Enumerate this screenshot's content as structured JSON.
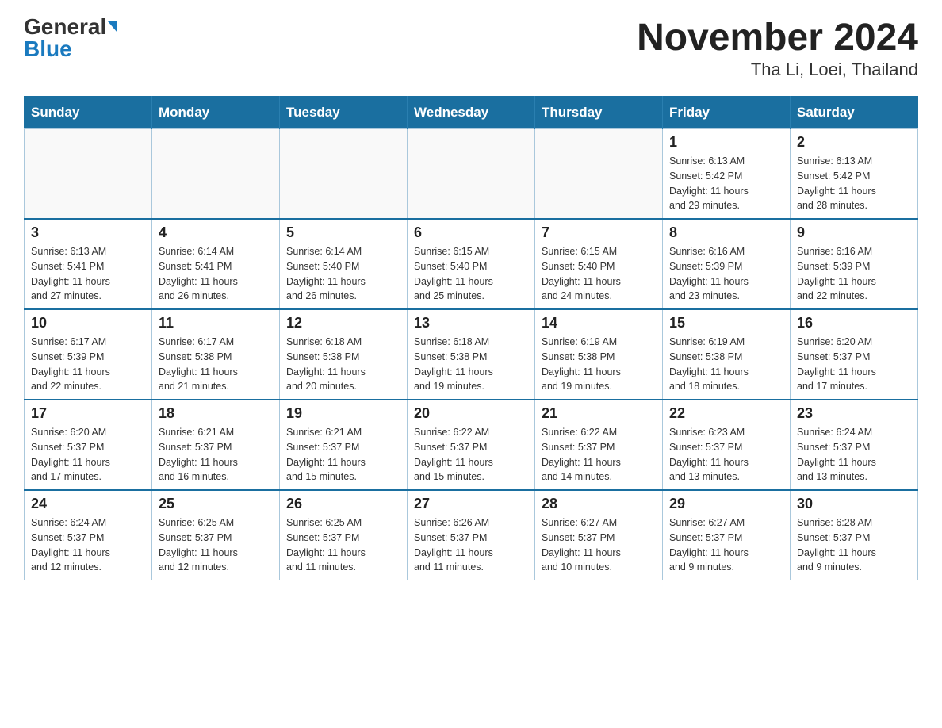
{
  "header": {
    "logo_general": "General",
    "logo_blue": "Blue",
    "title": "November 2024",
    "subtitle": "Tha Li, Loei, Thailand"
  },
  "days_of_week": [
    "Sunday",
    "Monday",
    "Tuesday",
    "Wednesday",
    "Thursday",
    "Friday",
    "Saturday"
  ],
  "weeks": [
    {
      "days": [
        {
          "num": "",
          "info": ""
        },
        {
          "num": "",
          "info": ""
        },
        {
          "num": "",
          "info": ""
        },
        {
          "num": "",
          "info": ""
        },
        {
          "num": "",
          "info": ""
        },
        {
          "num": "1",
          "info": "Sunrise: 6:13 AM\nSunset: 5:42 PM\nDaylight: 11 hours\nand 29 minutes."
        },
        {
          "num": "2",
          "info": "Sunrise: 6:13 AM\nSunset: 5:42 PM\nDaylight: 11 hours\nand 28 minutes."
        }
      ]
    },
    {
      "days": [
        {
          "num": "3",
          "info": "Sunrise: 6:13 AM\nSunset: 5:41 PM\nDaylight: 11 hours\nand 27 minutes."
        },
        {
          "num": "4",
          "info": "Sunrise: 6:14 AM\nSunset: 5:41 PM\nDaylight: 11 hours\nand 26 minutes."
        },
        {
          "num": "5",
          "info": "Sunrise: 6:14 AM\nSunset: 5:40 PM\nDaylight: 11 hours\nand 26 minutes."
        },
        {
          "num": "6",
          "info": "Sunrise: 6:15 AM\nSunset: 5:40 PM\nDaylight: 11 hours\nand 25 minutes."
        },
        {
          "num": "7",
          "info": "Sunrise: 6:15 AM\nSunset: 5:40 PM\nDaylight: 11 hours\nand 24 minutes."
        },
        {
          "num": "8",
          "info": "Sunrise: 6:16 AM\nSunset: 5:39 PM\nDaylight: 11 hours\nand 23 minutes."
        },
        {
          "num": "9",
          "info": "Sunrise: 6:16 AM\nSunset: 5:39 PM\nDaylight: 11 hours\nand 22 minutes."
        }
      ]
    },
    {
      "days": [
        {
          "num": "10",
          "info": "Sunrise: 6:17 AM\nSunset: 5:39 PM\nDaylight: 11 hours\nand 22 minutes."
        },
        {
          "num": "11",
          "info": "Sunrise: 6:17 AM\nSunset: 5:38 PM\nDaylight: 11 hours\nand 21 minutes."
        },
        {
          "num": "12",
          "info": "Sunrise: 6:18 AM\nSunset: 5:38 PM\nDaylight: 11 hours\nand 20 minutes."
        },
        {
          "num": "13",
          "info": "Sunrise: 6:18 AM\nSunset: 5:38 PM\nDaylight: 11 hours\nand 19 minutes."
        },
        {
          "num": "14",
          "info": "Sunrise: 6:19 AM\nSunset: 5:38 PM\nDaylight: 11 hours\nand 19 minutes."
        },
        {
          "num": "15",
          "info": "Sunrise: 6:19 AM\nSunset: 5:38 PM\nDaylight: 11 hours\nand 18 minutes."
        },
        {
          "num": "16",
          "info": "Sunrise: 6:20 AM\nSunset: 5:37 PM\nDaylight: 11 hours\nand 17 minutes."
        }
      ]
    },
    {
      "days": [
        {
          "num": "17",
          "info": "Sunrise: 6:20 AM\nSunset: 5:37 PM\nDaylight: 11 hours\nand 17 minutes."
        },
        {
          "num": "18",
          "info": "Sunrise: 6:21 AM\nSunset: 5:37 PM\nDaylight: 11 hours\nand 16 minutes."
        },
        {
          "num": "19",
          "info": "Sunrise: 6:21 AM\nSunset: 5:37 PM\nDaylight: 11 hours\nand 15 minutes."
        },
        {
          "num": "20",
          "info": "Sunrise: 6:22 AM\nSunset: 5:37 PM\nDaylight: 11 hours\nand 15 minutes."
        },
        {
          "num": "21",
          "info": "Sunrise: 6:22 AM\nSunset: 5:37 PM\nDaylight: 11 hours\nand 14 minutes."
        },
        {
          "num": "22",
          "info": "Sunrise: 6:23 AM\nSunset: 5:37 PM\nDaylight: 11 hours\nand 13 minutes."
        },
        {
          "num": "23",
          "info": "Sunrise: 6:24 AM\nSunset: 5:37 PM\nDaylight: 11 hours\nand 13 minutes."
        }
      ]
    },
    {
      "days": [
        {
          "num": "24",
          "info": "Sunrise: 6:24 AM\nSunset: 5:37 PM\nDaylight: 11 hours\nand 12 minutes."
        },
        {
          "num": "25",
          "info": "Sunrise: 6:25 AM\nSunset: 5:37 PM\nDaylight: 11 hours\nand 12 minutes."
        },
        {
          "num": "26",
          "info": "Sunrise: 6:25 AM\nSunset: 5:37 PM\nDaylight: 11 hours\nand 11 minutes."
        },
        {
          "num": "27",
          "info": "Sunrise: 6:26 AM\nSunset: 5:37 PM\nDaylight: 11 hours\nand 11 minutes."
        },
        {
          "num": "28",
          "info": "Sunrise: 6:27 AM\nSunset: 5:37 PM\nDaylight: 11 hours\nand 10 minutes."
        },
        {
          "num": "29",
          "info": "Sunrise: 6:27 AM\nSunset: 5:37 PM\nDaylight: 11 hours\nand 9 minutes."
        },
        {
          "num": "30",
          "info": "Sunrise: 6:28 AM\nSunset: 5:37 PM\nDaylight: 11 hours\nand 9 minutes."
        }
      ]
    }
  ]
}
